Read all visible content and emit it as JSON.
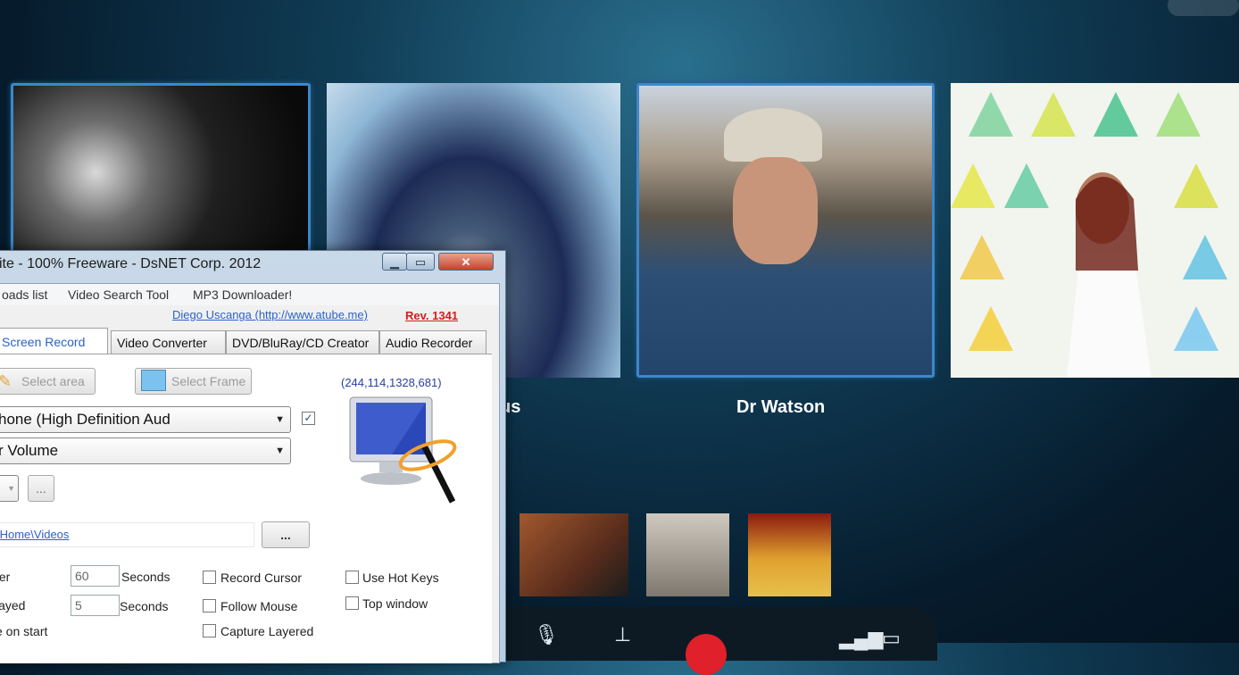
{
  "call": {
    "participants": [
      {
        "name": ""
      },
      {
        "name": "us"
      },
      {
        "name": "Dr Watson"
      },
      {
        "name": ""
      }
    ]
  },
  "app": {
    "title": "ite - 100% Freeware - DsNET Corp. 2012",
    "menu": [
      "oads list",
      "Video Search Tool",
      "MP3 Downloader!"
    ],
    "author_link": "Diego Uscanga (http://www.atube.me)",
    "revision": "Rev. 1341",
    "tabs": [
      "Screen Record",
      "Video Converter",
      "DVD/BluRay/CD Creator",
      "Audio Recorder"
    ],
    "select_area_label": "Select area",
    "select_frame_label": "Select Frame",
    "coords": "(244,114,1328,681)",
    "audio_device": "hone (High Definition Aud",
    "audio_source": "r Volume",
    "browse_small": "...",
    "output_path": "\\Home\\Videos",
    "browse_path": "...",
    "rows": [
      {
        "label": "ter",
        "value": "60",
        "unit": "Seconds"
      },
      {
        "label": "layed",
        "value": "5",
        "unit": "Seconds"
      },
      {
        "label": "e on start"
      }
    ],
    "options": [
      "Record Cursor",
      "Follow Mouse",
      "Capture Layered"
    ],
    "options2": [
      "Use Hot Keys",
      "Top window"
    ]
  }
}
